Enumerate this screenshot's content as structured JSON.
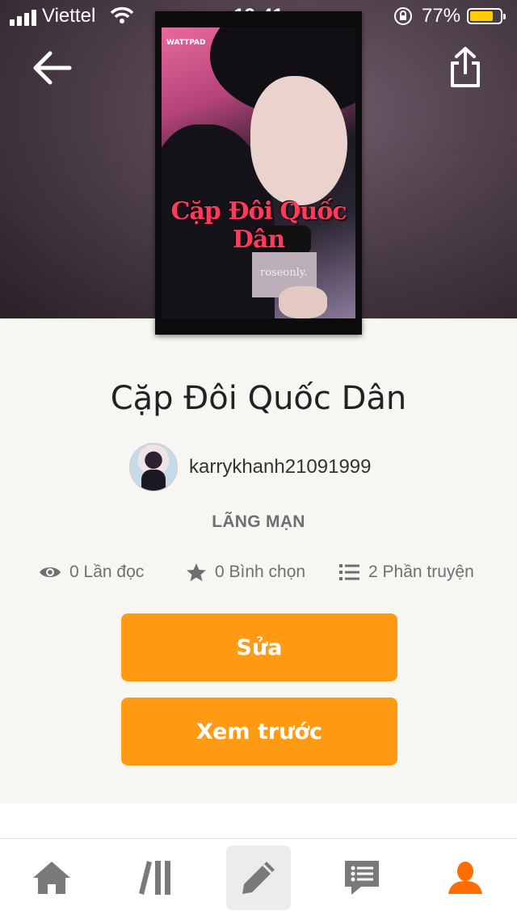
{
  "status_bar": {
    "carrier": "Viettel",
    "time": "19:41",
    "battery_percent": "77%",
    "battery_level": 0.77
  },
  "cover": {
    "title_text": "Cặp Đôi Quốc Dân",
    "logo_text": "WATTPAD",
    "mic_text": "roseonly."
  },
  "story": {
    "title": "Cặp Đôi Quốc Dân",
    "author": "karrykhanh21091999",
    "genre": "LÃNG MẠN"
  },
  "stats": {
    "reads": "0 Lần đọc",
    "votes": "0 Bình chọn",
    "parts": "2 Phần truyện"
  },
  "buttons": {
    "edit": "Sửa",
    "preview": "Xem trước"
  },
  "tab_bar": {
    "active": "write",
    "accent_color": "#ff6d00",
    "items": [
      "home-icon",
      "library-icon",
      "write-icon",
      "messages-icon",
      "profile-icon"
    ]
  },
  "colors": {
    "primary_button": "#ff9a12",
    "text": "#222222",
    "muted": "#6f6f6f"
  }
}
